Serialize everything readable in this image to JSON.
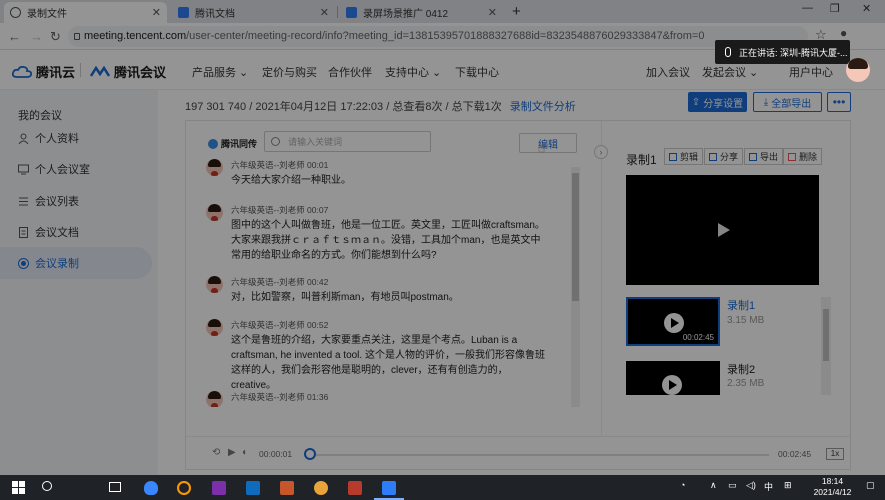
{
  "browser": {
    "tabs": [
      {
        "label": "录制文件",
        "active": true
      },
      {
        "label": "腾讯文档",
        "active": false
      },
      {
        "label": "录屏场景推广 0412",
        "active": false
      }
    ],
    "url_host": "meeting.tencent.com",
    "url_path": "/user-center/meeting-record/info?meeting_id=13815395701888327688id=8323548876029333847&from=0"
  },
  "header": {
    "logo_cloud": "腾讯云",
    "logo_meeting": "腾讯会议",
    "nav": [
      "产品服务",
      "定价与购买",
      "合作伙伴",
      "支持中心",
      "下载中心"
    ],
    "right": [
      "加入会议",
      "发起会议",
      "用户中心"
    ]
  },
  "speaker_toast": {
    "label": "正在讲话: 深圳-腾讯大厦-..."
  },
  "sidebar": {
    "title": "我的会议",
    "items": [
      {
        "label": "个人资料"
      },
      {
        "label": "个人会议室"
      },
      {
        "label": "会议列表"
      },
      {
        "label": "会议文档"
      },
      {
        "label": "会议录制",
        "active": true
      }
    ]
  },
  "meeting": {
    "info": "197 301 740 / 2021年04月12日 17:22:03 / 总查看8次 / 总下载1次",
    "analysis_link": "录制文件分析",
    "share_settings": "分享设置",
    "download_all": "全部导出",
    "more": "•••"
  },
  "transcript": {
    "brand": "腾讯同传",
    "search_placeholder": "请输入关键词",
    "edit_label": "编辑",
    "entries": [
      {
        "speaker": "六年级英语--刘老师 00:01",
        "text": "今天给大家介绍一种职业。"
      },
      {
        "speaker": "六年级英语--刘老师 00:07",
        "text": "图中的这个人叫做鲁班，他是一位工匠。英文里，工匠叫做craftsman。大家来跟我拼ｃｒａｆｔｓｍａｎ。没错，工具加个man，也是英文中常用的给职业命名的方式。你们能想到什么吗?"
      },
      {
        "speaker": "六年级英语--刘老师 00:42",
        "text": "对，比如警察，叫普利斯man，有地员叫postman。"
      },
      {
        "speaker": "六年级英语--刘老师 00:52",
        "text": "这个是鲁班的介绍，大家要重点关注，这里是个考点。Luban is a craftsman, he invented a tool. 这个是人物的评价，一般我们形容像鲁班这样的人，我们会形容他是聪明的，clever，还有有创造力的，creative。"
      },
      {
        "speaker": "六年级英语--刘老师 01:36",
        "text": ""
      }
    ]
  },
  "recordings": {
    "title": "录制1",
    "actions": [
      "剪辑",
      "分享",
      "导出",
      "删除"
    ],
    "items": [
      {
        "name": "录制1",
        "size": "3.15 MB",
        "duration": "00:02:45",
        "selected": true
      },
      {
        "name": "录制2",
        "size": "2.35 MB",
        "duration": "",
        "selected": false
      }
    ]
  },
  "player": {
    "current": "00:00:01",
    "total": "00:02:45",
    "speed": "1x",
    "progress": 0.0
  },
  "taskbar": {
    "time": "18:14",
    "date": "2021/4/12",
    "ime": "中"
  },
  "colors": {
    "accent": "#1c6bd6",
    "overlay": "rgba(0,0,0,0.42)"
  }
}
